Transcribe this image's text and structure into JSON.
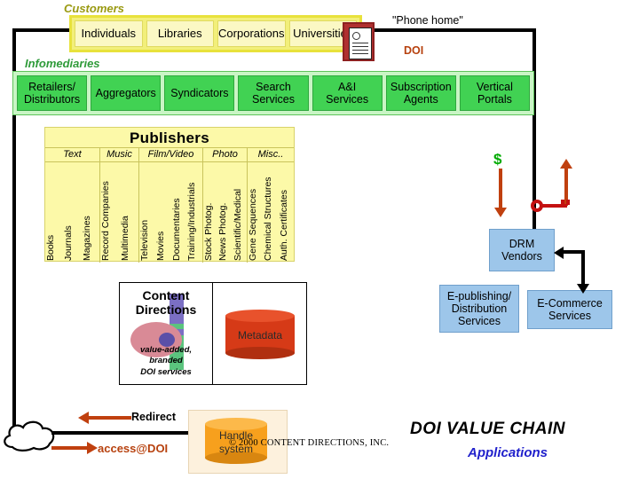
{
  "diagram": {
    "title": "DOI VALUE CHAIN",
    "subtitle": "Applications",
    "copyright": "© 2000 CONTENT DIRECTIONS, INC.",
    "doi_label": "DOI",
    "phone_home": "\"Phone home\""
  },
  "customers": {
    "label": "Customers",
    "items": [
      {
        "label": "Individuals"
      },
      {
        "label": "Libraries"
      },
      {
        "label": "Corporations"
      },
      {
        "label": "Universities"
      }
    ]
  },
  "infomediaries": {
    "label": "Infomediaries",
    "items": [
      {
        "label": "Retailers/\nDistributors"
      },
      {
        "label": "Aggregators"
      },
      {
        "label": "Syndicators"
      },
      {
        "label": "Search\nServices"
      },
      {
        "label": "A&I\nServices"
      },
      {
        "label": "Subscription\nAgents"
      },
      {
        "label": "Vertical\nPortals"
      }
    ]
  },
  "publishers": {
    "title": "Publishers",
    "groups": [
      {
        "header": "Text",
        "items": [
          "Books",
          "Journals",
          "Magazines"
        ]
      },
      {
        "header": "Music",
        "items": [
          "Record Companies",
          "Multimedia"
        ]
      },
      {
        "header": "Film/Video",
        "items": [
          "Television",
          "Movies",
          "Documentaries",
          "Training/Industrials"
        ]
      },
      {
        "header": "Photo",
        "items": [
          "Stock Photog.",
          "News Photog.",
          "Scientific/Medical"
        ]
      },
      {
        "header": "Misc..",
        "items": [
          "Gene Sequences",
          "Chemical Structures",
          "Auth. Certificates"
        ]
      }
    ]
  },
  "content_directions": {
    "title": "Content\nDirections",
    "subtitle": "value-added,\nbranded\nDOI services",
    "metadata_label": "Metadata"
  },
  "right_boxes": {
    "drm": "DRM\nVendors",
    "epublishing": "E-publishing/\nDistribution\nServices",
    "ecommerce": "E-Commerce\nServices"
  },
  "bottom": {
    "redirect": "Redirect",
    "access": "access@DOI",
    "handle": "Handle\nsystem"
  },
  "icons": {
    "dollar": "$",
    "key": "key-icon",
    "document": "document-icon",
    "cloud": "cloud-icon"
  },
  "colors": {
    "customers_band": "#f2ef7a",
    "customers_cell": "#fbf8c4",
    "infomediaries_band": "#c9f5c5",
    "infomediaries_cell": "#41d253",
    "publishers": "#fcf9a8",
    "blue_box": "#9dc6ea",
    "metadata_cyl": "#d63a17",
    "handle_cyl": "#f7a01d",
    "doi_text": "#b7410e",
    "applications_text": "#2222cc",
    "dollar_green": "#00aa00",
    "key_red": "#c41111"
  }
}
